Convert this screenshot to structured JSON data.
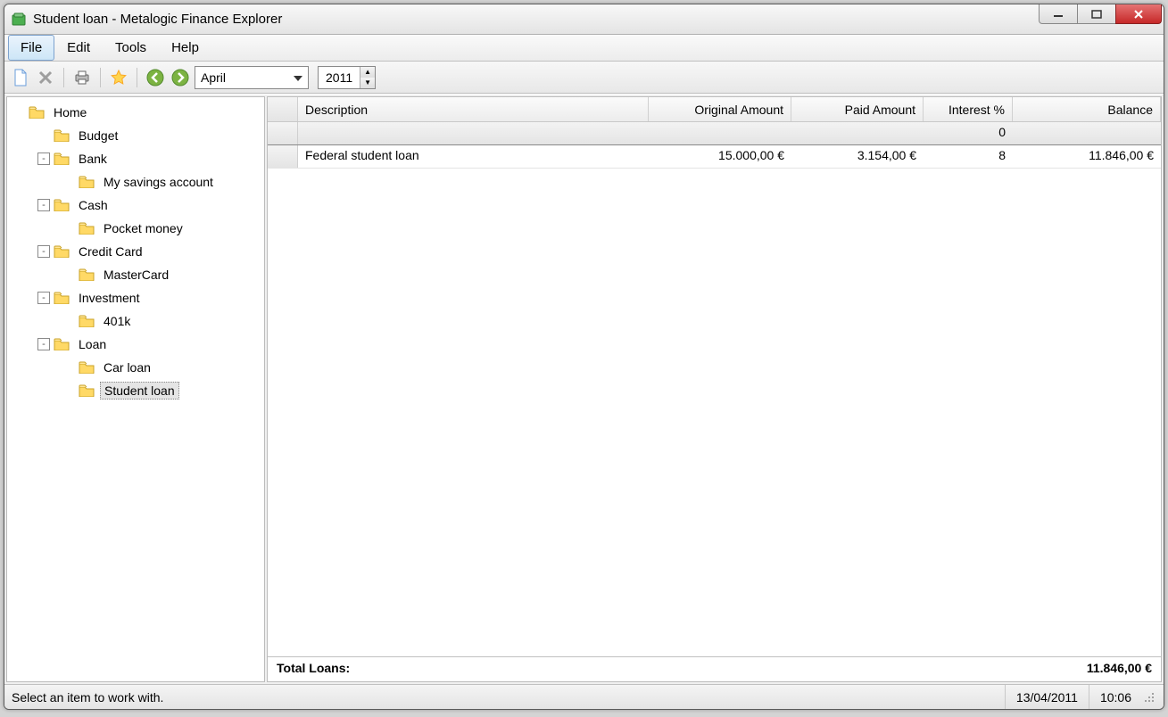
{
  "title": "Student loan - Metalogic Finance Explorer",
  "menubar": [
    "File",
    "Edit",
    "Tools",
    "Help"
  ],
  "toolbar": {
    "month": "April",
    "year": "2011"
  },
  "tree": [
    {
      "label": "Home",
      "level": 0,
      "toggle": null,
      "selected": false
    },
    {
      "label": "Budget",
      "level": 1,
      "toggle": null,
      "selected": false
    },
    {
      "label": "Bank",
      "level": 1,
      "toggle": "-",
      "selected": false
    },
    {
      "label": "My savings account",
      "level": 2,
      "toggle": null,
      "selected": false
    },
    {
      "label": "Cash",
      "level": 1,
      "toggle": "-",
      "selected": false
    },
    {
      "label": "Pocket money",
      "level": 2,
      "toggle": null,
      "selected": false
    },
    {
      "label": "Credit Card",
      "level": 1,
      "toggle": "-",
      "selected": false
    },
    {
      "label": "MasterCard",
      "level": 2,
      "toggle": null,
      "selected": false
    },
    {
      "label": "Investment",
      "level": 1,
      "toggle": "-",
      "selected": false
    },
    {
      "label": "401k",
      "level": 2,
      "toggle": null,
      "selected": false
    },
    {
      "label": "Loan",
      "level": 1,
      "toggle": "-",
      "selected": false
    },
    {
      "label": "Car loan",
      "level": 2,
      "toggle": null,
      "selected": false
    },
    {
      "label": "Student loan",
      "level": 2,
      "toggle": null,
      "selected": true
    }
  ],
  "grid": {
    "columns": {
      "description": "Description",
      "original": "Original Amount",
      "paid": "Paid Amount",
      "interest": "Interest %",
      "balance": "Balance"
    },
    "summary": {
      "interest": "0"
    },
    "rows": [
      {
        "description": "Federal student loan",
        "original": "15.000,00 €",
        "paid": "3.154,00 €",
        "interest": "8",
        "balance": "11.846,00 €"
      }
    ],
    "total_label": "Total Loans:",
    "total_value": "11.846,00 €"
  },
  "statusbar": {
    "message": "Select an item to work with.",
    "date": "13/04/2011",
    "time": "10:06"
  }
}
